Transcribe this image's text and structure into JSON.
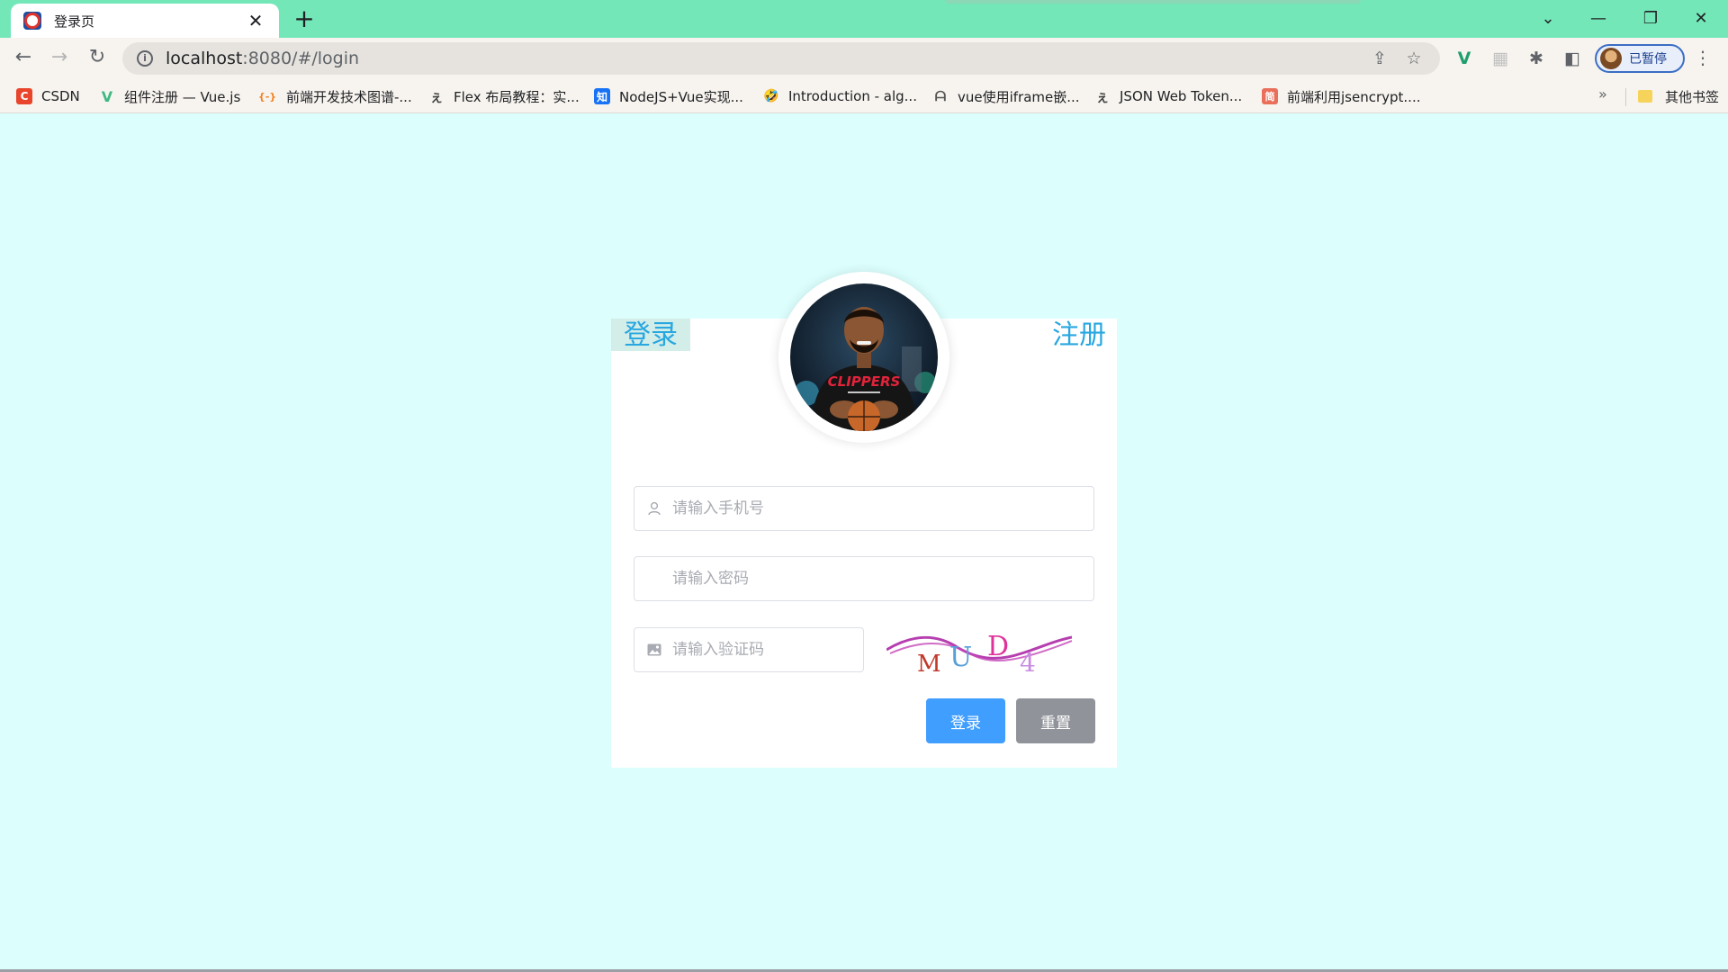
{
  "browser": {
    "tab_title": "登录页",
    "tab_close": "✕",
    "new_tab": "+",
    "url_host": "localhost",
    "url_rest": ":8080/#/login",
    "profile_label": "已暂停",
    "window_controls": [
      "⌄",
      "—",
      "❐",
      "✕"
    ]
  },
  "bookmarks": {
    "items": [
      {
        "label": "CSDN",
        "icon": "csdn-icon",
        "icon_text": "C",
        "icon_color": "#e8452c"
      },
      {
        "label": "组件注册 — Vue.js",
        "icon": "vue-icon",
        "icon_text": "V",
        "icon_color": "#3fb983"
      },
      {
        "label": "前端开发技术图谱-...",
        "icon": "code-icon",
        "icon_text": "{-}",
        "icon_color": "#f58220"
      },
      {
        "label": "Flex 布局教程：实...",
        "icon": "ruanyf-icon",
        "icon_text": "ぇ",
        "icon_color": "#444444"
      },
      {
        "label": "NodeJS+Vue实现...",
        "icon": "zhihu-icon",
        "icon_text": "知",
        "icon_color": "#1772f6"
      },
      {
        "label": "Introduction - alg...",
        "icon": "emoji-icon",
        "icon_text": "🤣",
        "icon_color": "#f3c623"
      },
      {
        "label": "vue使用iframe嵌...",
        "icon": "segment-icon",
        "icon_text": "ᗩ",
        "icon_color": "#555555"
      },
      {
        "label": "JSON Web Token...",
        "icon": "ruanyf-icon",
        "icon_text": "ぇ",
        "icon_color": "#444444"
      },
      {
        "label": "前端利用jsencrypt....",
        "icon": "jianshu-icon",
        "icon_text": "简",
        "icon_color": "#ea6f5a"
      }
    ],
    "more": "»",
    "other_folder": "其他书签"
  },
  "login": {
    "tab_login": "登录",
    "tab_register": "注册",
    "phone_placeholder": "请输入手机号",
    "password_placeholder": "请输入密码",
    "captcha_placeholder": "请输入验证码",
    "captcha_chars": [
      "M",
      "U",
      "D",
      "4"
    ],
    "submit_label": "登录",
    "reset_label": "重置"
  },
  "colors": {
    "page_bg": "#dcfffd",
    "tabstrip": "#74e7b9",
    "primary": "#409eff",
    "info": "#909399",
    "tab_text": "#28a7e0"
  }
}
